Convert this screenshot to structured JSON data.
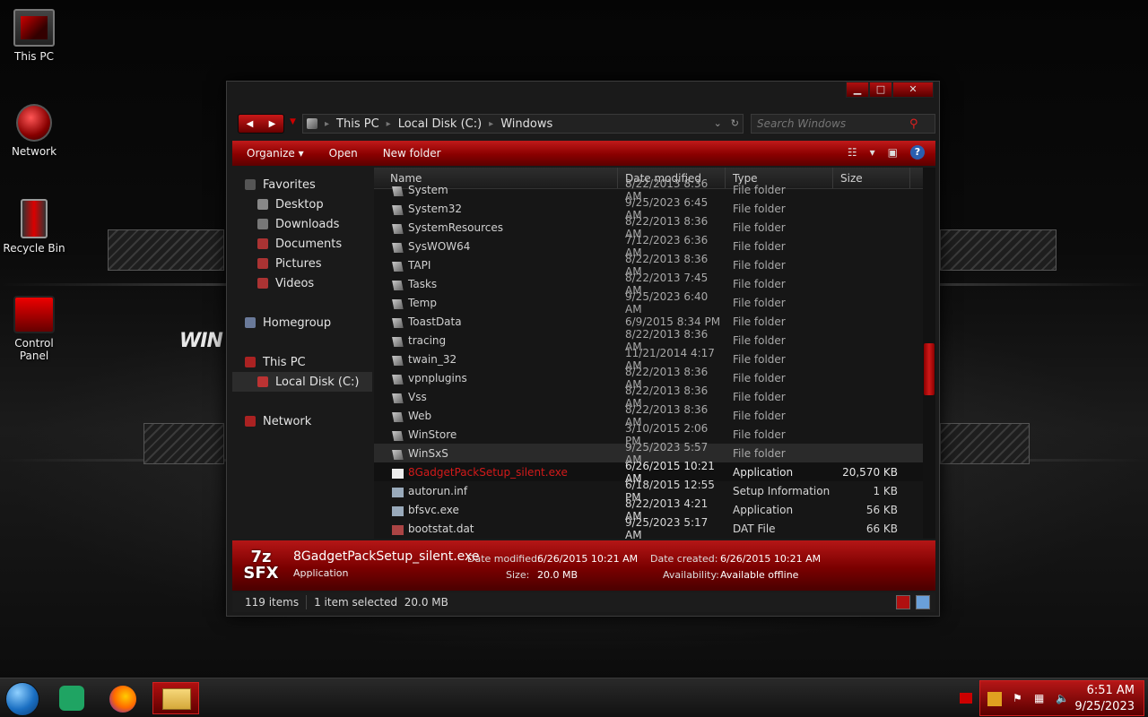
{
  "desktop": {
    "icons": [
      {
        "label": "This PC",
        "icon": "computer-icon"
      },
      {
        "label": "Network",
        "icon": "network-icon"
      },
      {
        "label": "Recycle Bin",
        "icon": "recycle-bin-icon"
      },
      {
        "label": "Control Panel",
        "icon": "control-panel-icon"
      }
    ],
    "wallpaper_logo": "WIN"
  },
  "window": {
    "controls": {
      "minimize": "▁",
      "maximize": "□",
      "close": "✕"
    },
    "address": {
      "crumbs": [
        "This PC",
        "Local Disk (C:)",
        "Windows"
      ]
    },
    "search": {
      "placeholder": "Search Windows"
    },
    "toolbar": {
      "organize": "Organize",
      "open": "Open",
      "new_folder": "New folder"
    },
    "nav": {
      "favorites": "Favorites",
      "desktop": "Desktop",
      "downloads": "Downloads",
      "documents": "Documents",
      "pictures": "Pictures",
      "videos": "Videos",
      "homegroup": "Homegroup",
      "this_pc": "This PC",
      "local_disk": "Local Disk (C:)",
      "network": "Network"
    },
    "columns": {
      "name": "Name",
      "date": "Date modified",
      "type": "Type",
      "size": "Size"
    },
    "files": [
      {
        "name": "System",
        "date": "8/22/2013 8:36 AM",
        "type": "File folder",
        "size": ""
      },
      {
        "name": "System32",
        "date": "9/25/2023 6:45 AM",
        "type": "File folder",
        "size": ""
      },
      {
        "name": "SystemResources",
        "date": "8/22/2013 8:36 AM",
        "type": "File folder",
        "size": ""
      },
      {
        "name": "SysWOW64",
        "date": "7/12/2023 6:36 AM",
        "type": "File folder",
        "size": ""
      },
      {
        "name": "TAPI",
        "date": "8/22/2013 8:36 AM",
        "type": "File folder",
        "size": ""
      },
      {
        "name": "Tasks",
        "date": "8/22/2013 7:45 AM",
        "type": "File folder",
        "size": ""
      },
      {
        "name": "Temp",
        "date": "9/25/2023 6:40 AM",
        "type": "File folder",
        "size": ""
      },
      {
        "name": "ToastData",
        "date": "6/9/2015 8:34 PM",
        "type": "File folder",
        "size": ""
      },
      {
        "name": "tracing",
        "date": "8/22/2013 8:36 AM",
        "type": "File folder",
        "size": ""
      },
      {
        "name": "twain_32",
        "date": "11/21/2014 4:17 AM",
        "type": "File folder",
        "size": ""
      },
      {
        "name": "vpnplugins",
        "date": "8/22/2013 8:36 AM",
        "type": "File folder",
        "size": ""
      },
      {
        "name": "Vss",
        "date": "8/22/2013 8:36 AM",
        "type": "File folder",
        "size": ""
      },
      {
        "name": "Web",
        "date": "8/22/2013 8:36 AM",
        "type": "File folder",
        "size": ""
      },
      {
        "name": "WinStore",
        "date": "3/10/2015 2:06 PM",
        "type": "File folder",
        "size": ""
      },
      {
        "name": "WinSxS",
        "date": "9/25/2023 5:57 AM",
        "type": "File folder",
        "size": ""
      },
      {
        "name": "8GadgetPackSetup_silent.exe",
        "date": "6/26/2015 10:21 AM",
        "type": "Application",
        "size": "20,570 KB"
      },
      {
        "name": "autorun.inf",
        "date": "6/18/2015 12:55 PM",
        "type": "Setup Information",
        "size": "1 KB"
      },
      {
        "name": "bfsvc.exe",
        "date": "8/22/2013 4:21 AM",
        "type": "Application",
        "size": "56 KB"
      },
      {
        "name": "bootstat.dat",
        "date": "9/25/2023 5:17 AM",
        "type": "DAT File",
        "size": "66 KB"
      }
    ],
    "details": {
      "icon_text": "7z SFX",
      "name": "8GadgetPackSetup_silent.exe",
      "kind": "Application",
      "date_modified_label": "Date modified:",
      "date_modified": "6/26/2015 10:21 AM",
      "size_label": "Size:",
      "size": "20.0 MB",
      "date_created_label": "Date created:",
      "date_created": "6/26/2015 10:21 AM",
      "availability_label": "Availability:",
      "availability": "Available offline"
    },
    "status": {
      "count": "119 items",
      "selected": "1 item selected  20.0 MB"
    }
  },
  "taskbar": {
    "clock_time": "6:51 AM",
    "clock_date": "9/25/2023"
  }
}
